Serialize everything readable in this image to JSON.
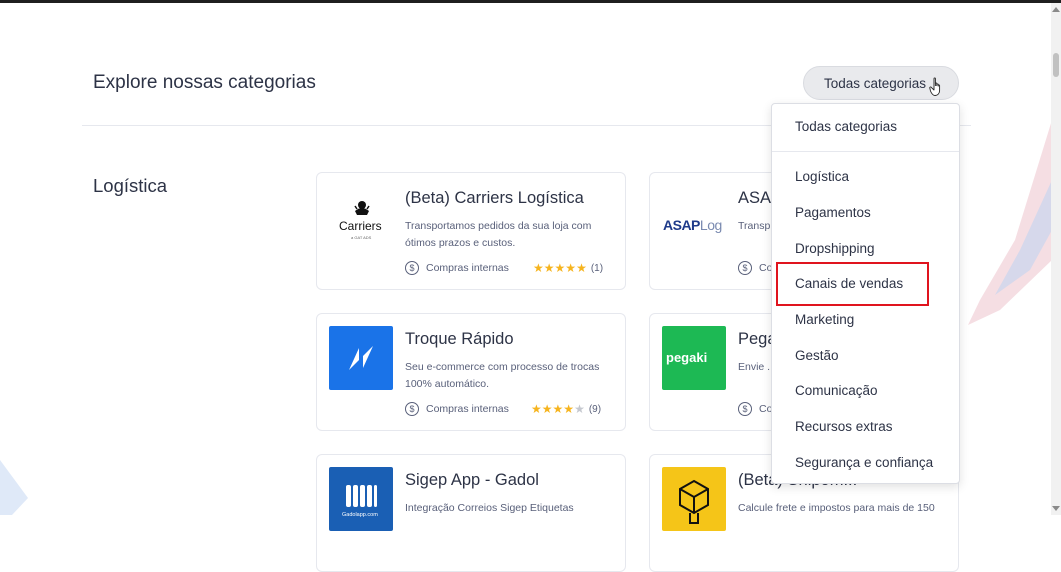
{
  "header": {
    "title": "Explore nossas categorias",
    "categories_button": "Todas categorias"
  },
  "section": {
    "title": "Logística"
  },
  "cards": [
    {
      "title": "(Beta) Carriers Logística",
      "description": "Transportamos pedidos da sua loja com ótimos prazos e custos.",
      "meta": "Compras internas",
      "rating": 5,
      "count": "(1)",
      "logo_text": "Carriers",
      "logo_sub": "a GAT ADS"
    },
    {
      "title": "ASAP",
      "description": "Transp... exigên...",
      "meta": "Co",
      "logo_text": "ASAPLog"
    },
    {
      "title": "Troque Rápido",
      "description": "Seu e-commerce com processo de trocas 100% automático.",
      "meta": "Compras internas",
      "rating": 4,
      "count": "(9)"
    },
    {
      "title": "Pega",
      "description": "Envie ... 70% no...",
      "meta": "Co",
      "logo_text": "pegaki"
    },
    {
      "title": "Sigep App - Gadol",
      "description": "Integração Correios Sigep Etiquetas",
      "logo_text": "Gadolapp.com"
    },
    {
      "title": "(Beta) Shipom...",
      "description": "Calcule frete e impostos para mais de 150"
    }
  ],
  "dropdown": {
    "items": [
      "Todas categorias",
      "Logística",
      "Pagamentos",
      "Dropshipping",
      "Canais de vendas",
      "Marketing",
      "Gestão",
      "Comunicação",
      "Recursos extras",
      "Segurança e confiança"
    ],
    "highlighted": "Canais de vendas"
  },
  "colors": {
    "accent_blue": "#1a73e8",
    "star": "#f6b41e",
    "highlight_red": "#e0141e",
    "pegaki_green": "#1db954",
    "troque_blue": "#1a73e8",
    "shipom_yellow": "#f5c518"
  },
  "icons": {
    "cursor": "hand-pointer-icon",
    "meta": "dollar-circle-icon",
    "rating": "star-icon"
  }
}
